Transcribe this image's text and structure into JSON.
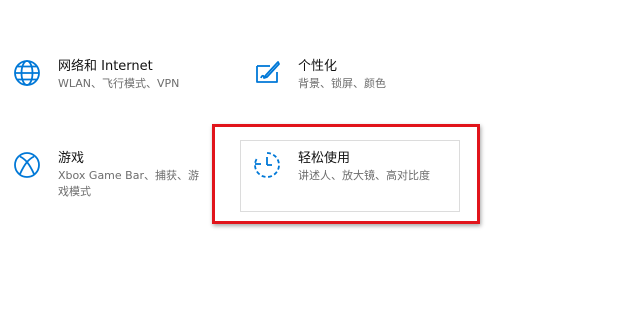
{
  "colors": {
    "accent": "#0078d7",
    "highlight": "#e1141b"
  },
  "tiles": [
    {
      "id": "network",
      "icon": "globe-icon",
      "title": "网络和 Internet",
      "desc": "WLAN、飞行模式、VPN"
    },
    {
      "id": "personalization",
      "icon": "paint-brush-icon",
      "title": "个性化",
      "desc": "背景、锁屏、颜色"
    },
    {
      "id": "gaming",
      "icon": "xbox-icon",
      "title": "游戏",
      "desc": "Xbox Game Bar、捕获、游戏模式"
    },
    {
      "id": "ease_of_access",
      "icon": "ease-of-access-timer-icon",
      "title": "轻松使用",
      "desc": "讲述人、放大镜、高对比度"
    }
  ]
}
